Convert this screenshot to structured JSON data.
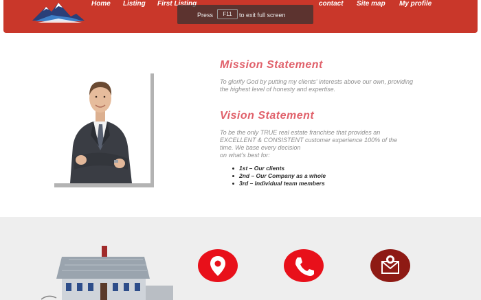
{
  "nav": {
    "items": [
      {
        "label": "Home"
      },
      {
        "label": "Listing"
      },
      {
        "label": "First Listing"
      },
      {
        "label": "contact"
      },
      {
        "label": "Site map"
      },
      {
        "label": "My profile"
      }
    ]
  },
  "fullscreen_notice": {
    "text_before": "Press",
    "key": "F11",
    "text_after": "to exit full screen"
  },
  "mission": {
    "heading": "Mission Statement",
    "line1": "To glorify God by putting my clients' interests above our own, providing",
    "line2": "the highest level of honesty and expertise."
  },
  "vision": {
    "heading": "Vision Statement",
    "line1": "To be the only TRUE real estate franchise that provides an",
    "line2": "EXCELLENT & CONSISTENT customer experience 100% of the",
    "line3": "time. We base every decision",
    "line4": "on what's best for:"
  },
  "priorities": [
    {
      "text": "1st – Our clients"
    },
    {
      "text": "2nd – Our Company as a whole"
    },
    {
      "text": "3rd – Individual team members"
    }
  ],
  "colors": {
    "header": "#c9372a",
    "heading": "#e0606a",
    "icon_red": "#e8101a",
    "icon_dark_red": "#8e1a14"
  },
  "icons": {
    "location": "location-pin-icon",
    "phone": "phone-icon",
    "mail": "mail-icon"
  }
}
